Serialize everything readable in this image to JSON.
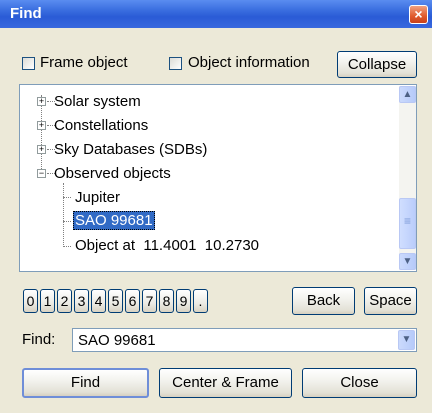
{
  "window": {
    "title": "Find",
    "close_glyph": "×"
  },
  "options": {
    "frame_object": {
      "label": "Frame object",
      "checked": false
    },
    "object_information": {
      "label": "Object information",
      "checked": false
    },
    "collapse_label": "Collapse"
  },
  "tree": {
    "items": [
      {
        "label": "Solar system",
        "expander": "+",
        "level": 0
      },
      {
        "label": "Constellations",
        "expander": "+",
        "level": 0
      },
      {
        "label": "Sky Databases (SDBs)",
        "expander": "+",
        "level": 0
      },
      {
        "label": "Observed objects",
        "expander": "−",
        "level": 0
      },
      {
        "label": "Jupiter",
        "level": 1
      },
      {
        "label": "SAO 99681",
        "level": 1,
        "selected": true
      },
      {
        "label": "Object at  11.4001  10.2730",
        "level": 1
      }
    ],
    "scroll_up_glyph": "▲",
    "scroll_down_glyph": "▼",
    "thumb_grip_glyph": "≡"
  },
  "keypad": {
    "keys": [
      "0",
      "1",
      "2",
      "3",
      "4",
      "5",
      "6",
      "7",
      "8",
      "9",
      "."
    ],
    "back_label": "Back",
    "space_label": "Space"
  },
  "find": {
    "label": "Find:",
    "value": "SAO 99681",
    "dropdown_glyph": "▼"
  },
  "actions": {
    "find_label": "Find",
    "center_frame_label": "Center & Frame",
    "close_label": "Close"
  },
  "colors": {
    "titlebar": "#2a5bd6",
    "selection": "#316ac5",
    "close_button": "#e05a2c",
    "window_face": "#ece9d8"
  }
}
